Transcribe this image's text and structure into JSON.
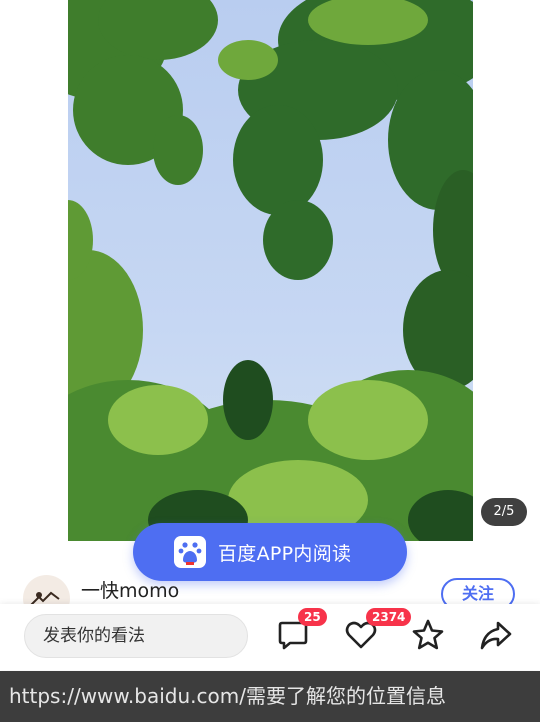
{
  "photo": {
    "description_icon": "tree-canopy-photo",
    "sky_color": "#c4d6f3",
    "leaf_colors": [
      "#2f6b2a",
      "#4f8f33",
      "#7fb445",
      "#1f4d1f"
    ]
  },
  "gallery": {
    "counter": "2/5"
  },
  "app_banner": {
    "icon": "baidu-paw-icon",
    "label": "百度APP内阅读",
    "accent": "#4e6ef2"
  },
  "author": {
    "name": "一快momo",
    "follow_label": "关注"
  },
  "action_bar": {
    "comment_placeholder": "发表你的看法",
    "comment_count": "25",
    "like_count": "2374",
    "icons": [
      "comment-icon",
      "heart-icon",
      "star-icon",
      "share-icon"
    ],
    "badge_color": "#f7334a"
  },
  "status": {
    "message": "https://www.baidu.com/需要了解您的位置信息"
  }
}
